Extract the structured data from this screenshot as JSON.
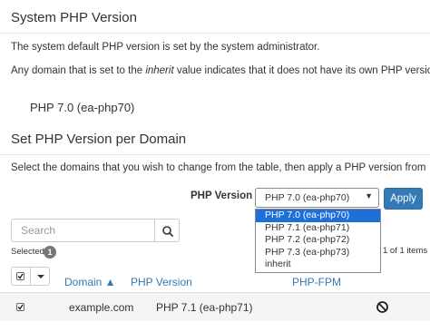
{
  "section1": {
    "title": "System PHP Version",
    "desc1": "The system default PHP version is set by the system administrator.",
    "desc2_prefix": "Any domain that is set to the ",
    "desc2_em": "inherit",
    "desc2_suffix": " value indicates that it does not have its own PHP version e",
    "current_version": "PHP 7.0 (ea-php70)"
  },
  "section2": {
    "title": "Set PHP Version per Domain",
    "desc": "Select the domains that you wish to change from the table, then apply a PHP version from"
  },
  "version_control": {
    "label": "PHP Version",
    "selected": "PHP 7.0 (ea-php70)",
    "options": [
      "PHP 7.0 (ea-php70)",
      "PHP 7.1 (ea-php71)",
      "PHP 7.2 (ea-php72)",
      "PHP 7.3 (ea-php73)",
      "inherit"
    ],
    "highlighted_index": 0,
    "apply_label": "Apply"
  },
  "search": {
    "placeholder": "Search"
  },
  "selection": {
    "label": "Selected",
    "count": "1"
  },
  "paging": {
    "text": "1 of 1 items"
  },
  "table": {
    "headers": {
      "domain": "Domain ▲",
      "php_version": "PHP Version",
      "php_fpm": "PHP-FPM"
    },
    "rows": [
      {
        "domain": "example.com",
        "php_version": "PHP 7.1 (ea-php71)",
        "fpm_icon": "no-entry-icon",
        "checked": true
      }
    ]
  },
  "colors": {
    "accent": "#337ab7",
    "highlight": "#1e6fd9"
  }
}
